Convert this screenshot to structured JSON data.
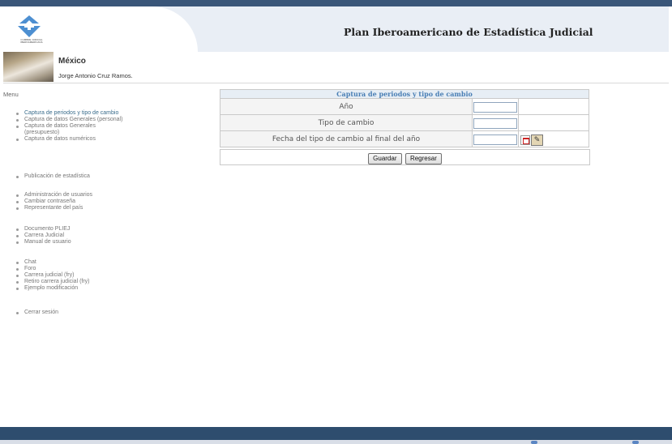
{
  "header": {
    "logo_text": "CUMBRE JUDICIAL IBEROAMERICANA",
    "title": "Plan Iberoamericano de Estadística Judicial"
  },
  "user": {
    "country": "México",
    "name": "Jorge Antonio Cruz Ramos."
  },
  "menu": {
    "title": "Menu",
    "groups": [
      [
        "Captura de periodos y tipo de cambio",
        "Captura de datos Generales (personal)",
        "Captura de datos Generales (presupuesto)",
        "Captura de datos numéricos"
      ],
      [
        "Publicación de estadística"
      ],
      [
        "Administración de usuarios",
        "Cambiar contraseña",
        "Representante del país"
      ],
      [
        "Documento PLIEJ",
        "Carrera Judicial",
        "Manual de usuario"
      ],
      [
        "Chat",
        "Foro",
        "Carrera judicial (fry)",
        "Retiro carrera judicial (fry)",
        "Ejemplo modificación"
      ],
      [
        "Cerrar sesión"
      ]
    ]
  },
  "form": {
    "caption": "Captura de periodos y tipo de cambio",
    "fields": [
      {
        "label": "Año",
        "value": ""
      },
      {
        "label": "Tipo de cambio",
        "value": ""
      },
      {
        "label": "Fecha del tipo de cambio al final del año",
        "value": ""
      }
    ]
  },
  "buttons": {
    "save": "Guardar",
    "back": "Regresar"
  },
  "colors": {
    "accent": "#3a5679",
    "caption_text": "#4a7fb5",
    "active_menu": "#3a6d8c"
  }
}
